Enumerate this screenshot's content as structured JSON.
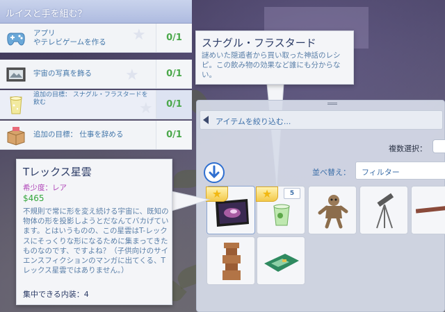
{
  "aspiration": {
    "title": "ルイスと手を組む？",
    "rows": [
      {
        "label": "アプリ\nやテレビゲームを作る",
        "progress": "0/1",
        "icon": "gamepad-icon"
      },
      {
        "label": "宇宙の写真を飾る",
        "progress": "0/1",
        "icon": "framed-photo-icon"
      },
      {
        "label": "追加の目標： スナグル・フラスタードを\n飲む",
        "progress": "0/1",
        "icon": "drink-glass-icon"
      },
      {
        "label": "追加の目標： 仕事を辞める",
        "progress": "0/1",
        "icon": "cardboard-box-icon"
      }
    ]
  },
  "item_tooltip": {
    "title": "スナグル・フラスタード",
    "description": "謎めいた隠遁者から買い取った神話のレシピ。この飲み物の効果など誰にも分からない。"
  },
  "buy_panel": {
    "filter_text": "アイテムを絞り込む...",
    "multi_select_label": "複数選択：",
    "sort_label": "並べ替え：",
    "sort_value": "フィルター",
    "items": [
      {
        "name": "nebula-poster",
        "starred": true
      },
      {
        "name": "snuggle-fluster-drink",
        "starred": true,
        "count": "5"
      },
      {
        "name": "voodoo-doll"
      },
      {
        "name": "telescope"
      },
      {
        "name": "wooden-object"
      },
      {
        "name": "ancient-artifact"
      },
      {
        "name": "circuit-board-device"
      }
    ]
  },
  "object_tooltip": {
    "name": "Tレックス星雲",
    "rarity": "希少度：レア",
    "price_symbol": "$",
    "price": "465",
    "description": "不規則で常に形を変え続ける宇宙に、既知の物体の形を投影しようとだなんてバカげています。とはいうものの、この星雲はT-レックスにそっくりな形になるために集まってきたものなのです、ですよね？（子供向けのサイエンスフィクションのマンガに出てくる、Tレックス星雲ではありません。）",
    "focus": "集中できる内装：4"
  },
  "colors": {
    "accent_blue": "#3b6ea8",
    "progress_green": "#4aa84a",
    "rarity_purple": "#b046b8",
    "price_green": "#33a63b"
  }
}
